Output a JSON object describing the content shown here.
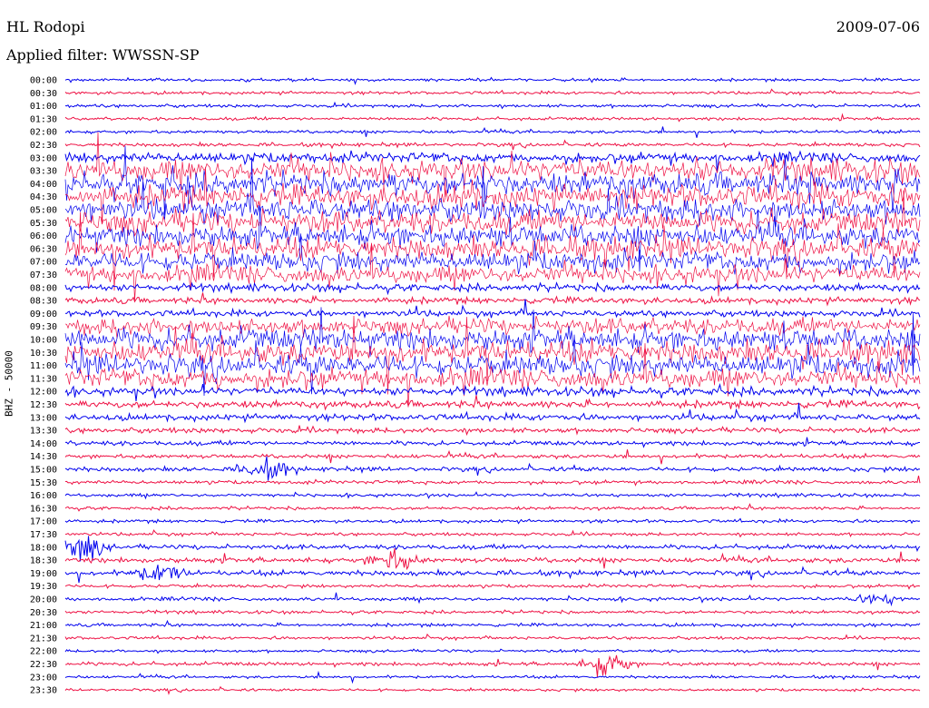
{
  "header": {
    "station": "HL Rodopi",
    "date": "2009-07-06",
    "filter": "Applied filter: WWSSN-SP"
  },
  "colors": {
    "trace_a": "#0000ee",
    "trace_b": "#ee1144",
    "text": "#000000",
    "background": "#ffffff"
  },
  "chart_data": {
    "type": "line",
    "ylabel": "BHZ - 50000",
    "y_ticks": [
      "00:00",
      "00:30",
      "01:00",
      "01:30",
      "02:00",
      "02:30",
      "03:00",
      "03:30",
      "04:00",
      "04:30",
      "05:00",
      "05:30",
      "06:00",
      "06:30",
      "07:00",
      "07:30",
      "08:00",
      "08:30",
      "09:00",
      "09:30",
      "10:00",
      "10:30",
      "11:00",
      "11:30",
      "12:00",
      "12:30",
      "13:00",
      "13:30",
      "14:00",
      "14:30",
      "15:00",
      "15:30",
      "16:00",
      "16:30",
      "17:00",
      "17:30",
      "18:00",
      "18:30",
      "19:00",
      "19:30",
      "20:00",
      "20:30",
      "21:00",
      "21:30",
      "22:00",
      "22:30",
      "23:00",
      "23:30"
    ],
    "trace_colors": [
      "blue",
      "red"
    ],
    "x_range_minutes": [
      0,
      30
    ],
    "grid": false,
    "activity_levels": [
      0.03,
      0.04,
      0.05,
      0.05,
      0.05,
      0.08,
      0.4,
      1.0,
      1.0,
      1.0,
      1.0,
      1.0,
      1.0,
      1.0,
      0.9,
      0.8,
      0.25,
      0.2,
      0.2,
      0.7,
      1.0,
      1.0,
      1.0,
      0.9,
      0.3,
      0.25,
      0.2,
      0.15,
      0.12,
      0.1,
      0.12,
      0.08,
      0.06,
      0.05,
      0.05,
      0.05,
      0.12,
      0.15,
      0.15,
      0.06,
      0.08,
      0.05,
      0.05,
      0.04,
      0.03,
      0.08,
      0.03,
      0.03
    ],
    "notable_events": [
      {
        "trace": "15:00",
        "minute": 7.0,
        "amplitude": 0.5
      },
      {
        "trace": "18:00",
        "minute": 0.6,
        "amplitude": 0.6
      },
      {
        "trace": "18:30",
        "minute": 11.5,
        "amplitude": 0.5
      },
      {
        "trace": "19:00",
        "minute": 3.3,
        "amplitude": 0.45
      },
      {
        "trace": "22:30",
        "minute": 19.0,
        "amplitude": 0.6
      },
      {
        "trace": "20:00",
        "minute": 28.5,
        "amplitude": 0.3
      }
    ]
  }
}
